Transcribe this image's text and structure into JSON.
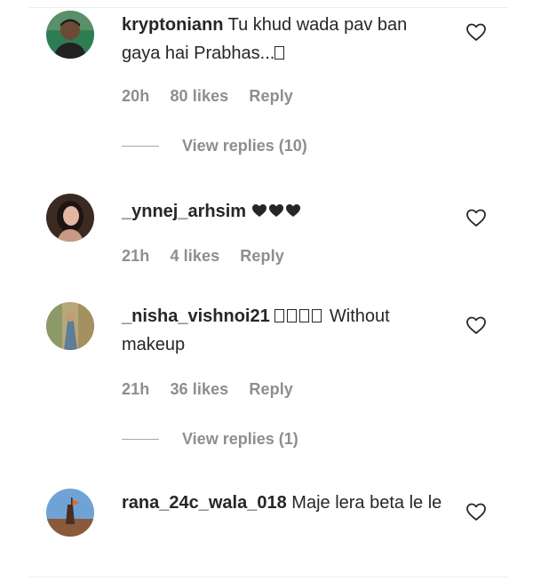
{
  "comments": [
    {
      "username": "kryptoniann",
      "text": "Tu khud wada pav ban gaya hai Prabhas...",
      "time": "20h",
      "likes": "80 likes",
      "reply": "Reply",
      "view_replies": "View replies (10)"
    },
    {
      "username": "_ynnej_arhsim",
      "text": "",
      "emoji_icon": "three-black-hearts",
      "time": "21h",
      "likes": "4 likes",
      "reply": "Reply"
    },
    {
      "username": "_nisha_vishnoi21",
      "text": "Without makeup",
      "time": "21h",
      "likes": "36 likes",
      "reply": "Reply",
      "view_replies": "View replies (1)"
    },
    {
      "username": "rana_24c_wala_018",
      "text": "Maje lera beta le le",
      "time": "",
      "likes": "",
      "reply": ""
    }
  ],
  "icons": {
    "like": "heart-outline-icon"
  },
  "colors": {
    "text": "#262626",
    "meta": "#8e8e8e"
  }
}
